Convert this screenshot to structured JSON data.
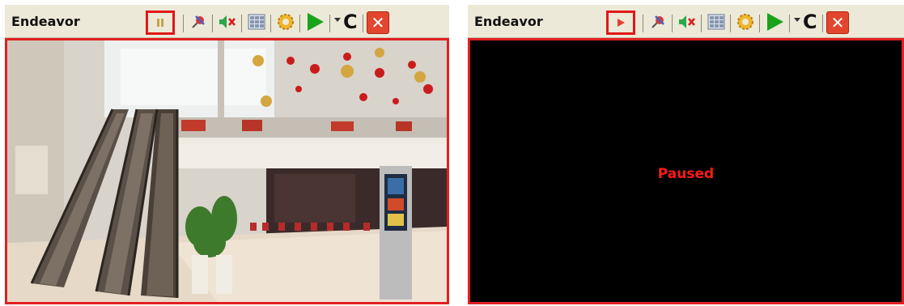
{
  "panels": [
    {
      "title": "Endeavor",
      "state": "playing",
      "highlighted_control": "pause-icon"
    },
    {
      "title": "Endeavor",
      "state": "paused",
      "highlighted_control": "play-icon",
      "status_text": "Paused"
    }
  ],
  "toolbar": {
    "c_label": "C",
    "close_label": "✕"
  },
  "colors": {
    "highlight": "#e01818",
    "paused_text": "#ff1a1a",
    "frame_border": "#e12020",
    "toolbar_bg": "#ece9d8",
    "play_green": "#1aa21a",
    "close_red": "#e2462e"
  }
}
